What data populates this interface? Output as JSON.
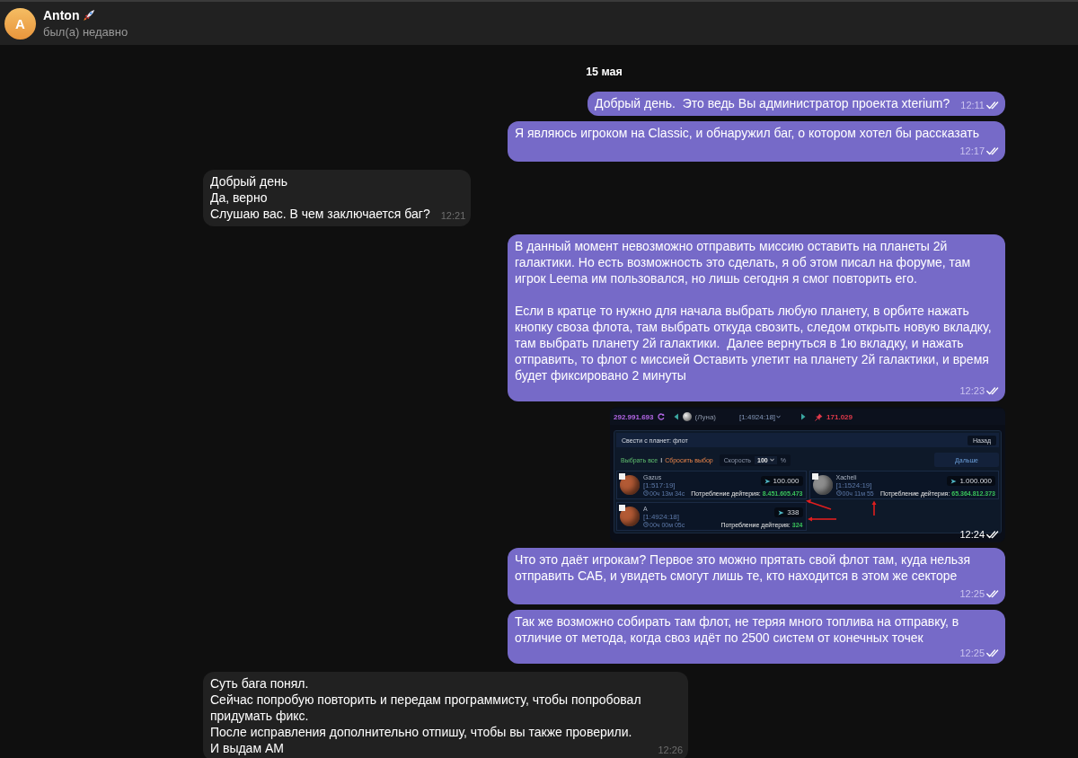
{
  "header": {
    "avatar_letter": "A",
    "name": "Anton",
    "status": "был(а) недавно"
  },
  "chat": {
    "date_separator": "15 мая",
    "messages": [
      {
        "outgoing": true,
        "kind": "text",
        "text": "Добрый день.  Это ведь Вы администратор проекта xterium?",
        "time": "12:11",
        "read": true
      },
      {
        "outgoing": true,
        "kind": "text",
        "text": "Я являюсь игроком на Classic, и обнаружил баг, о котором хотел бы рассказать",
        "time": "12:17",
        "read": true
      },
      {
        "outgoing": false,
        "kind": "text",
        "text": "Добрый день\nДа, верно\nСлушаю вас. В чем заключается баг?",
        "time": "12:21"
      },
      {
        "outgoing": true,
        "kind": "text",
        "text": "В данный момент невозможно отправить миссию оставить на планеты 2й галактики. Но есть возможность это сделать, я об этом писал на форуме, там игрок Leema им пользовался, но лишь сегодня я смог повторить его.\n\nЕсли в кратце то нужно для начала выбрать любую планету, в орбите нажать кнопку своза флота, там выбрать откуда свозить, следом открыть новую вкладку, там выбрать планету 2й галактики.  Далее вернуться в 1ю вкладку, и нажать отправить, то флот с миссией Оставить улетит на планету 2й галактики, и время будет фиксировано 2 минуты",
        "time": "12:23",
        "read": true
      },
      {
        "outgoing": true,
        "kind": "image",
        "time": "12:24",
        "read": true,
        "screenshot": {
          "top_bar": {
            "resource": "292.991.693",
            "moon": "(Луна)",
            "coords": "[1:4924:18]",
            "counter": "171.029"
          },
          "panel": {
            "title": "Свести с планет: флот",
            "back_button": "Назад",
            "select_all": "Выбрать все",
            "divider": "I",
            "reset": "Сбросить выбор",
            "speed_label": "Скорость",
            "speed_value": "100",
            "percent": "%",
            "next_button": "Дальше"
          },
          "planets": [
            {
              "checked": false,
              "color": "#b35a35",
              "name": "Gazus",
              "coords": "[1:517:19]",
              "time": "00ч 13м 34с",
              "ships": "100.000",
              "fuel_label": "Потребление дейтерия:",
              "fuel": "8.451.605.473"
            },
            {
              "checked": false,
              "color": "#8e8e8e",
              "name": "Xacheli",
              "coords": "[1:1524:19]",
              "time": "00ч 11м 55",
              "ships": "1.000.000",
              "fuel_label": "Потребление дейтерия:",
              "fuel": "65.364.812.373"
            },
            {
              "checked": false,
              "color": "#b35a35",
              "name": "A",
              "coords": "[1:4924:18]",
              "time": "00ч 00м 05с",
              "ships": "338",
              "fuel_label": "Потребление дейтерия:",
              "fuel": "324"
            }
          ]
        }
      },
      {
        "outgoing": true,
        "kind": "text",
        "text": "Что это даёт игрокам? Первое это можно прятать свой флот там, куда нельзя отправить САБ, и увидеть смогут лишь те, кто находится в этом же секторе",
        "time": "12:25",
        "read": true
      },
      {
        "outgoing": true,
        "kind": "text",
        "text": "Так же возможно собирать там флот, не теряя много топлива на отправку, в отличие от метода, когда своз идёт по 2500 систем от конечных точек",
        "time": "12:25",
        "read": true
      },
      {
        "outgoing": false,
        "kind": "text",
        "text": "Суть бага понял.\nСейчас попробую повторить и передам программисту, чтобы попробовал придумать фикс.\nПосле исправления дополнительно отпишу, чтобы вы также проверили.\nИ выдам АМ",
        "time": "12:26"
      }
    ]
  }
}
